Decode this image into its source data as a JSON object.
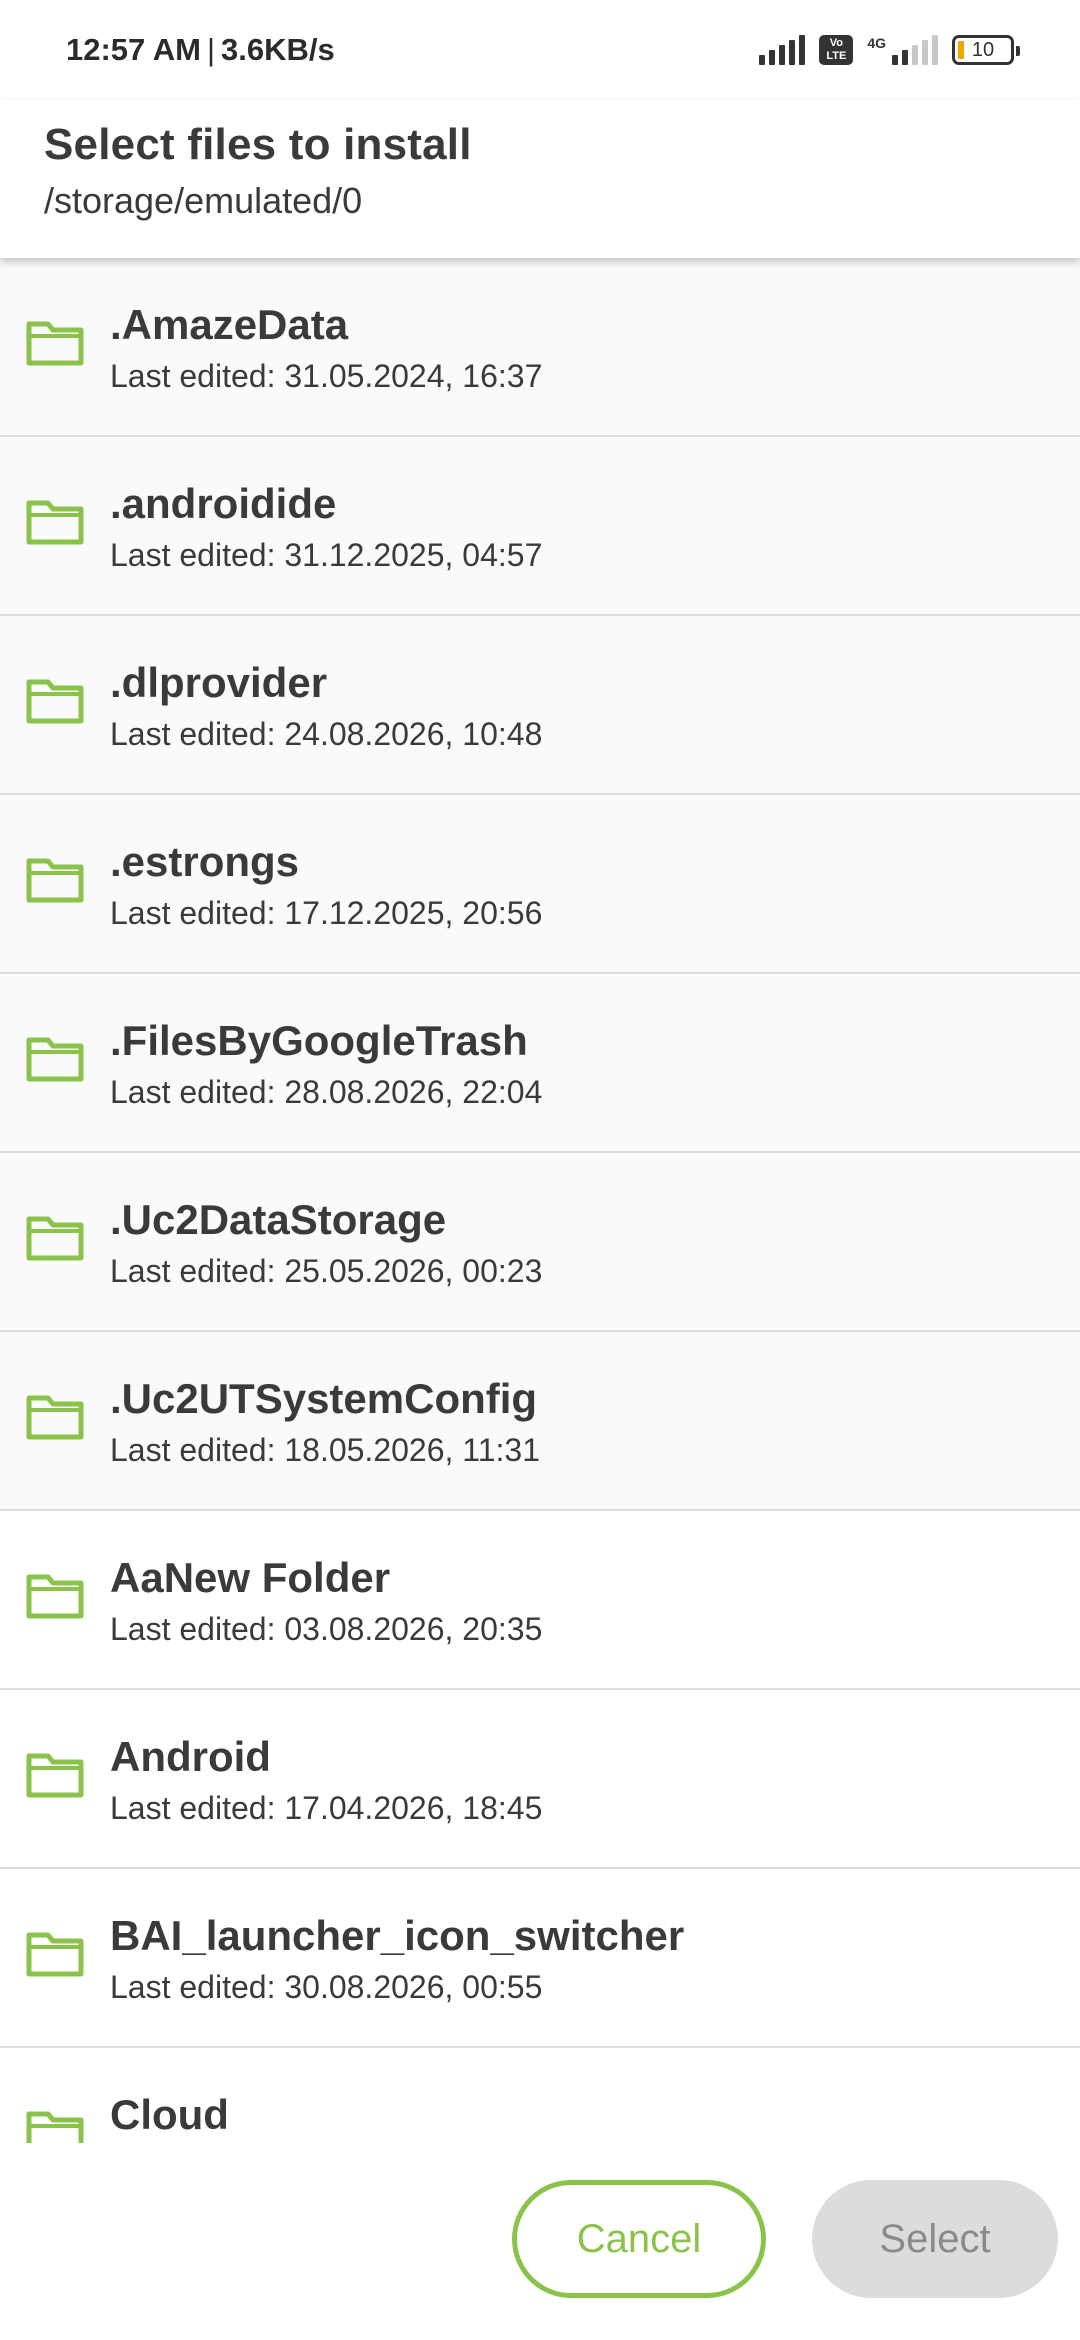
{
  "status_bar": {
    "time": "12:57 AM",
    "separator": "|",
    "speed": "3.6KB/s",
    "volte_top": "Vo",
    "volte_bottom": "LTE",
    "network": "4G",
    "battery": "10"
  },
  "header": {
    "title": "Select files to install",
    "path": "/storage/emulated/0"
  },
  "files": [
    {
      "name": ".AmazeData",
      "date": "Last edited: 31.05.2024, 16:37"
    },
    {
      "name": ".androidide",
      "date": "Last edited: 31.12.2025, 04:57"
    },
    {
      "name": ".dlprovider",
      "date": "Last edited: 24.08.2026, 10:48"
    },
    {
      "name": ".estrongs",
      "date": "Last edited: 17.12.2025, 20:56"
    },
    {
      "name": ".FilesByGoogleTrash",
      "date": "Last edited: 28.08.2026, 22:04"
    },
    {
      "name": ".Uc2DataStorage",
      "date": "Last edited: 25.05.2026, 00:23"
    },
    {
      "name": ".Uc2UTSystemConfig",
      "date": "Last edited: 18.05.2026, 11:31"
    },
    {
      "name": "AaNew Folder",
      "date": "Last edited: 03.08.2026, 20:35"
    },
    {
      "name": "Android",
      "date": "Last edited: 17.04.2026, 18:45"
    },
    {
      "name": "BAI_launcher_icon_switcher",
      "date": "Last edited: 30.08.2026, 00:55"
    },
    {
      "name": "Cloud",
      "date": ""
    }
  ],
  "icons": {
    "folder": "folder-icon"
  },
  "colors": {
    "accent": "#8bc34a",
    "disabled_bg": "#dcdcdc",
    "disabled_text": "#8a8a8a"
  },
  "buttons": {
    "cancel_label": "Cancel",
    "select_label": "Select"
  }
}
